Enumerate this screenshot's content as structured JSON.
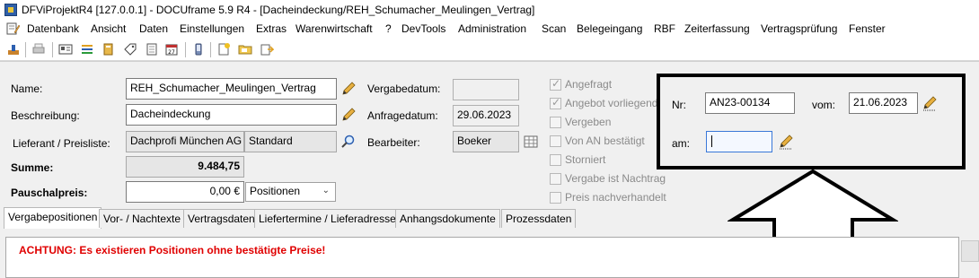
{
  "window": {
    "title": "DFViProjektR4 [127.0.0.1] - DOCUframe 5.9 R4 - [Dacheindeckung/REH_Schumacher_Meulingen_Vertrag]"
  },
  "menu": [
    "Datenbank",
    "Ansicht",
    "Daten",
    "Einstellungen",
    "Extras",
    "Warenwirtschaft",
    "?",
    "DevTools",
    "Administration",
    "Scan",
    "Belegeingang",
    "RBF",
    "Zeiterfassung",
    "Vertragsprüfung",
    "Fenster"
  ],
  "form": {
    "name": {
      "label": "Name:",
      "value": "REH_Schumacher_Meulingen_Vertrag"
    },
    "beschreibung": {
      "label": "Beschreibung:",
      "value": "Dacheindeckung"
    },
    "lieferant": {
      "label": "Lieferant / Preisliste:",
      "value": "Dachprofi München AG",
      "preisliste": "Standard"
    },
    "summe": {
      "label": "Summe:",
      "value": "9.484,75"
    },
    "pauschalpreis": {
      "label": "Pauschalpreis:",
      "value": "0,00 €",
      "mode": "Positionen"
    },
    "vergabedatum": {
      "label": "Vergabedatum:",
      "value": ""
    },
    "anfragedatum": {
      "label": "Anfragedatum:",
      "value": "29.06.2023"
    },
    "bearbeiter": {
      "label": "Bearbeiter:",
      "value": "Boeker"
    }
  },
  "status_checks": [
    {
      "label": "Angefragt",
      "checked": true
    },
    {
      "label": "Angebot vorliegend",
      "checked": true
    },
    {
      "label": "Vergeben",
      "checked": false
    },
    {
      "label": "Von AN bestätigt",
      "checked": false
    },
    {
      "label": "Storniert",
      "checked": false
    },
    {
      "label": "Vergabe ist Nachtrag",
      "checked": false
    },
    {
      "label": "Preis nachverhandelt",
      "checked": false
    }
  ],
  "offer": {
    "nr_label": "Nr:",
    "nr_value": "AN23-00134",
    "vom_label": "vom:",
    "vom_value": "21.06.2023",
    "am_label": "am:",
    "am_value": ""
  },
  "tabs": [
    "Vergabepositionen",
    "Vor- / Nachtexte",
    "Vertragsdaten",
    "Liefertermine / Lieferadresse",
    "Anhangsdokumente",
    "Prozessdaten"
  ],
  "warning": "ACHTUNG: Es existieren Positionen ohne bestätigte Preise!",
  "colors": {
    "warning": "#e00000",
    "highlight_border": "#000000"
  }
}
